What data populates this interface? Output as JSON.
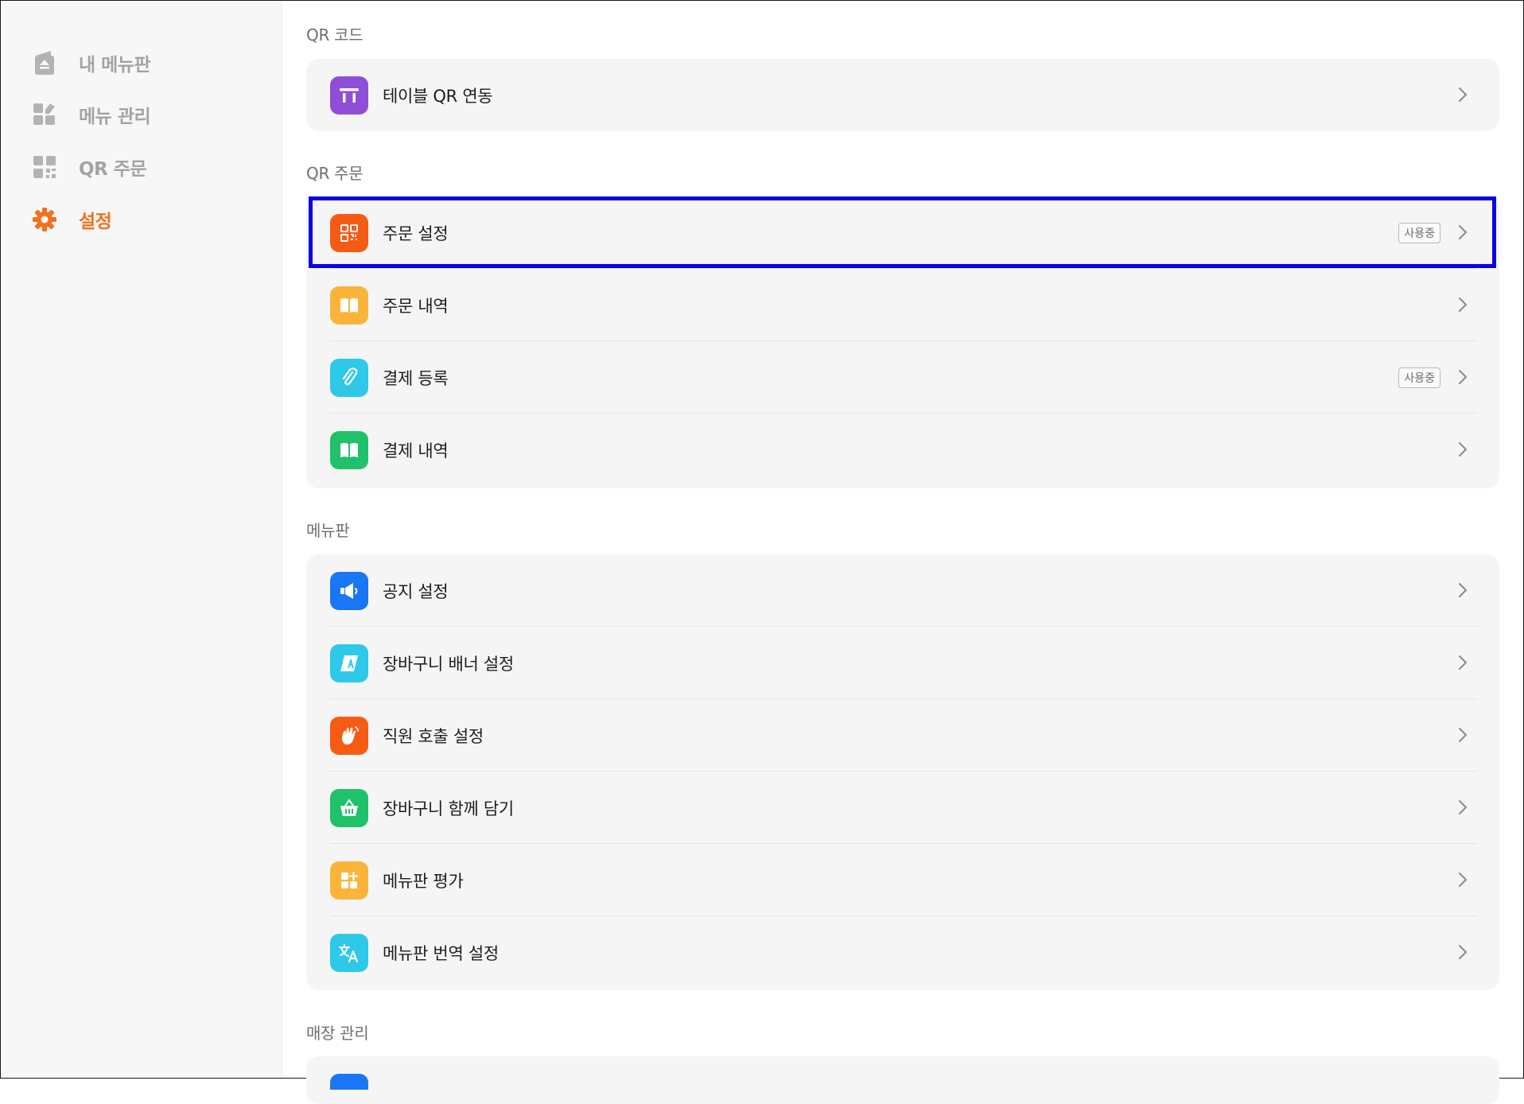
{
  "sidebar": {
    "items": [
      {
        "label": "내 메뉴판",
        "icon": "menu-board-icon",
        "active": false
      },
      {
        "label": "메뉴 관리",
        "icon": "grid-edit-icon",
        "active": false
      },
      {
        "label": "QR 주문",
        "icon": "qr-order-icon",
        "active": false
      },
      {
        "label": "설정",
        "icon": "gear-icon",
        "active": true
      }
    ]
  },
  "sections": {
    "qr_code": {
      "title": "QR 코드",
      "rows": [
        {
          "label": "테이블 QR 연동",
          "icon": "table-icon",
          "icon_color": "#8e4fd6"
        }
      ]
    },
    "qr_order": {
      "title": "QR 주문",
      "rows": [
        {
          "label": "주문 설정",
          "icon": "qr-code-icon",
          "icon_color": "#f65b14",
          "badge": "사용중"
        },
        {
          "label": "주문 내역",
          "icon": "book-icon",
          "icon_color": "#fbb43a"
        },
        {
          "label": "결제 등록",
          "icon": "paperclip-icon",
          "icon_color": "#2ec9e8",
          "badge": "사용중"
        },
        {
          "label": "결제 내역",
          "icon": "book-icon",
          "icon_color": "#1fc26b"
        }
      ]
    },
    "menuboard": {
      "title": "메뉴판",
      "rows": [
        {
          "label": "공지 설정",
          "icon": "megaphone-icon",
          "icon_color": "#1976f5"
        },
        {
          "label": "장바구니 배너 설정",
          "icon": "banner-icon",
          "icon_color": "#2ec9e8"
        },
        {
          "label": "직원 호출 설정",
          "icon": "hand-wave-icon",
          "icon_color": "#f65b14"
        },
        {
          "label": "장바구니 함께 담기",
          "icon": "basket-icon",
          "icon_color": "#1fc26b"
        },
        {
          "label": "메뉴판 평가",
          "icon": "apps-add-icon",
          "icon_color": "#fbb43a"
        },
        {
          "label": "메뉴판 번역 설정",
          "icon": "translate-icon",
          "icon_color": "#2ec9e8"
        }
      ]
    },
    "store": {
      "title": "매장 관리"
    }
  }
}
